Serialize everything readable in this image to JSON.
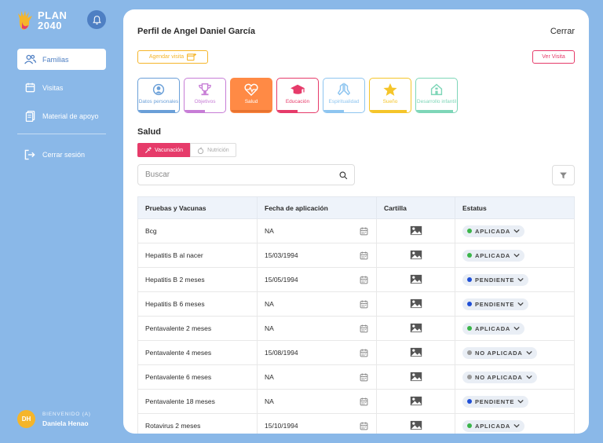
{
  "brand": {
    "name_line1": "PLAN",
    "name_line2": "2040"
  },
  "sidebar": {
    "items": [
      {
        "label": "Familias",
        "icon": "users-icon",
        "active": true
      },
      {
        "label": "Visitas",
        "icon": "calendar-icon",
        "active": false
      },
      {
        "label": "Material de apoyo",
        "icon": "documents-icon",
        "active": false
      }
    ],
    "logout_label": "Cerrar sesión",
    "user": {
      "initials": "DH",
      "welcome": "BIENVENIDO (A)",
      "name": "Daniela Henao"
    }
  },
  "header": {
    "title": "Perfil de Angel Daniel García",
    "close_label": "Cerrar",
    "schedule_label": "Agendar visita",
    "view_visit_label": "Ver Visita"
  },
  "categories": [
    {
      "label": "Datos personales",
      "icon": "person-icon",
      "color": "#6a9fd8",
      "progress": 0.9
    },
    {
      "label": "Objetivos",
      "icon": "trophy-icon",
      "color": "#c77dd6",
      "progress": 0.5
    },
    {
      "label": "Salud",
      "icon": "heart-pulse-icon",
      "color": "#ff8a45",
      "progress": 1,
      "active": true
    },
    {
      "label": "Educación",
      "icon": "graduation-cap-icon",
      "color": "#e63b6a",
      "progress": 0.5
    },
    {
      "label": "Espiritualidad",
      "icon": "praying-hands-icon",
      "color": "#8ec5f0",
      "progress": 0.5
    },
    {
      "label": "Sueño",
      "icon": "star-icon",
      "color": "#f5c52a",
      "progress": 0.9
    },
    {
      "label": "Desarrollo infantil",
      "icon": "house-icon",
      "color": "#7ed6b8",
      "progress": 0.9
    }
  ],
  "section": {
    "title": "Salud",
    "tabs": [
      {
        "label": "Vacunación",
        "active": true
      },
      {
        "label": "Nutrición",
        "active": false
      }
    ],
    "search_placeholder": "Buscar"
  },
  "table": {
    "headers": [
      "Pruebas y Vacunas",
      "Fecha de aplicación",
      "Cartilla",
      "Estatus"
    ],
    "rows": [
      {
        "name": "Bcg",
        "date": "NA",
        "status": "APLICADA",
        "status_color": "#3bb54a"
      },
      {
        "name": "Hepatitis B al nacer",
        "date": "15/03/1994",
        "status": "APLICADA",
        "status_color": "#3bb54a"
      },
      {
        "name": "Hepatitis B 2 meses",
        "date": "15/05/1994",
        "status": "PENDIENTE",
        "status_color": "#1f4fd6"
      },
      {
        "name": "Hepatitis B 6 meses",
        "date": "NA",
        "status": "PENDIENTE",
        "status_color": "#1f4fd6"
      },
      {
        "name": "Pentavalente 2 meses",
        "date": "NA",
        "status": "APLICADA",
        "status_color": "#3bb54a"
      },
      {
        "name": "Pentavalente 4 meses",
        "date": "15/08/1994",
        "status": "NO APLICADA",
        "status_color": "#999999"
      },
      {
        "name": "Pentavalente 6 meses",
        "date": "NA",
        "status": "NO APLICADA",
        "status_color": "#999999"
      },
      {
        "name": "Pentavalente 18 meses",
        "date": "NA",
        "status": "PENDIENTE",
        "status_color": "#1f4fd6"
      },
      {
        "name": "Rotavirus 2 meses",
        "date": "15/10/1994",
        "status": "APLICADA",
        "status_color": "#3bb54a"
      }
    ]
  }
}
